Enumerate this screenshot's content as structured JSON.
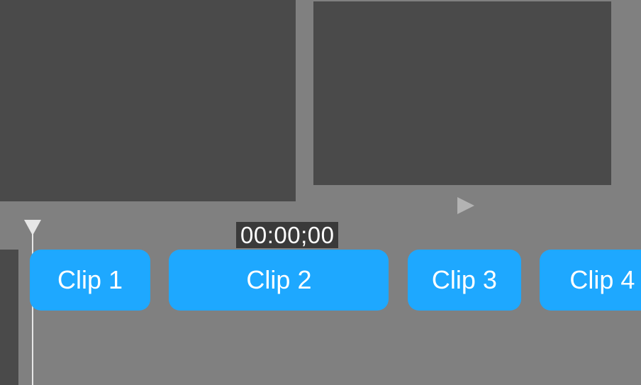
{
  "timecode": "00:00;00",
  "play_icon": "play",
  "clips": [
    {
      "label": "Clip 1"
    },
    {
      "label": "Clip 2"
    },
    {
      "label": "Clip 3"
    },
    {
      "label": "Clip 4"
    }
  ]
}
